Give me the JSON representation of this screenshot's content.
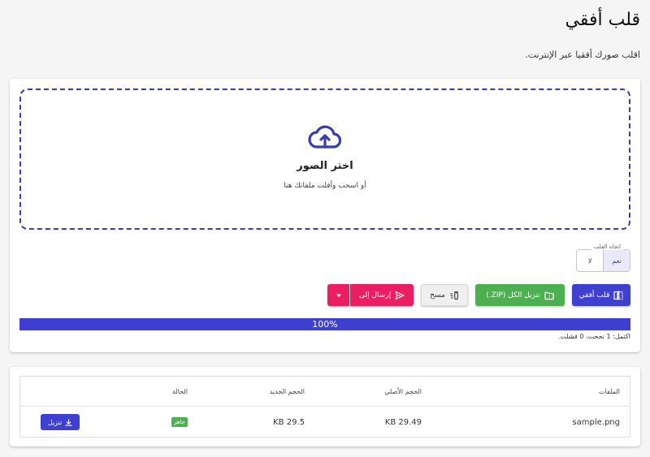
{
  "page": {
    "title": "قلب أفقي",
    "subtitle": "اقلب صورك أفقيا عبر الإنترنت."
  },
  "dropzone": {
    "title": "اختر الصور",
    "hint": "أو اسحب وأفلت ملفاتك هنا"
  },
  "flip_toggle": {
    "legend": "اتجاه القلب",
    "options": [
      "نعم",
      "لا"
    ],
    "selected": "نعم"
  },
  "actions": {
    "flip_label": "قلب أفقي",
    "zip_label": "تنزيل الكل (ZIP.)",
    "clear_label": "مسح",
    "send_label": "إرسال إلى"
  },
  "progress": {
    "value": 1.0,
    "label": "100%"
  },
  "status_line": "اكتمل: 1 نجحت، 0 فشلت.",
  "table": {
    "headers": {
      "files": "الملفات",
      "original_size": "الحجم الأصلي",
      "new_size": "الحجم الجديد",
      "status": "الحالة"
    },
    "rows": [
      {
        "name": "sample.png",
        "original_size": "KB 29.49",
        "new_size": "KB 29.5",
        "status": "جاهز",
        "download_label": "تنزيل"
      }
    ]
  },
  "colors": {
    "primary": "#4040d0",
    "success": "#4caf50",
    "accent": "#e91e63",
    "background": "#f5f5f5"
  },
  "icons": {
    "dropzone": "cloud-upload-icon",
    "flip": "flip-icon",
    "zip": "folder-zip-icon",
    "clear": "delete-sweep-icon",
    "send": "send-icon",
    "send_menu": "caret-down-icon",
    "download": "download-icon"
  }
}
